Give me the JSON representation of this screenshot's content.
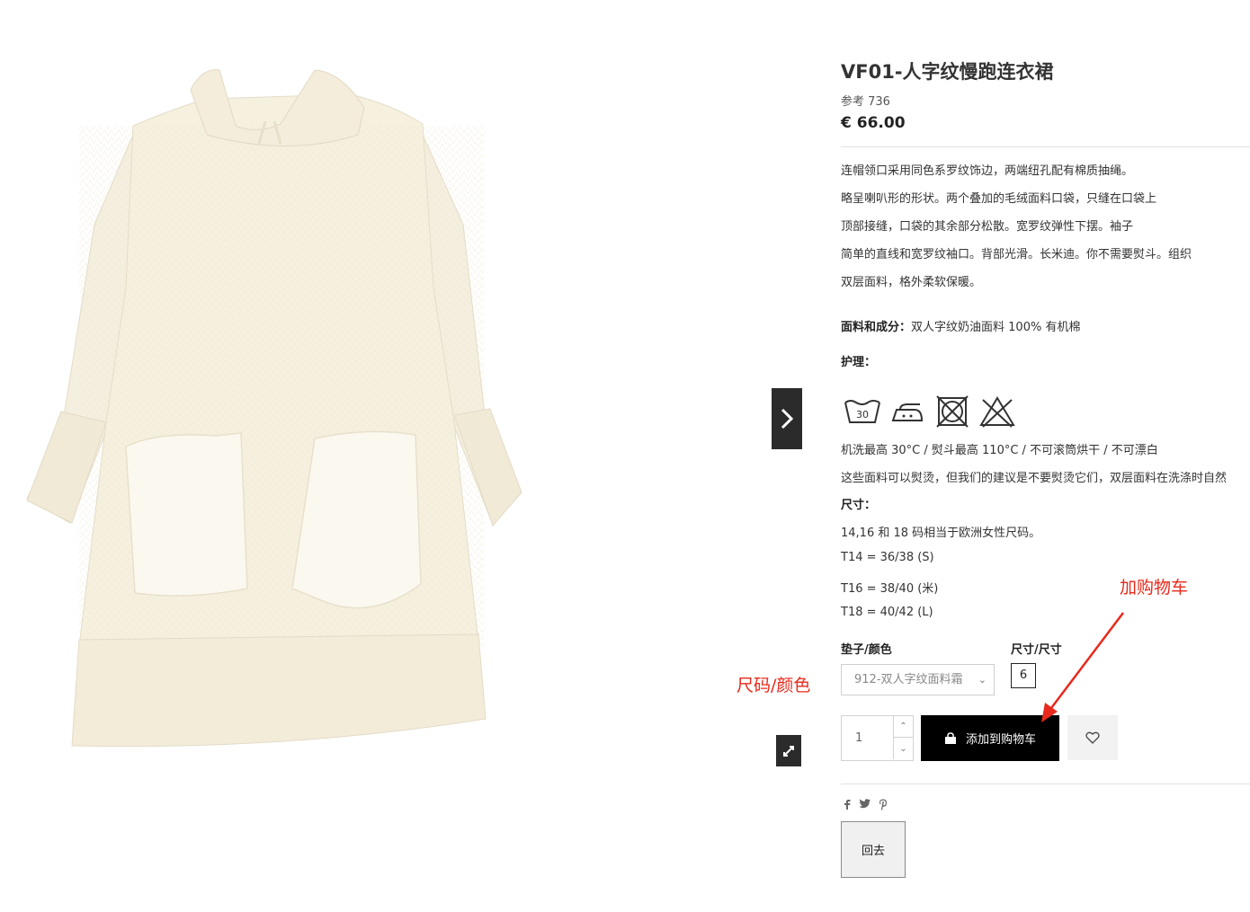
{
  "product": {
    "title": "VF01-人字纹慢跑连衣裙",
    "reference": "参考 736",
    "price": "€ 66.00",
    "description": [
      "连帽领口采用同色系罗纹饰边，两端纽孔配有棉质抽绳。",
      "略呈喇叭形的形状。两个叠加的毛绒面料口袋，只缝在口袋上",
      "顶部接缝，口袋的其余部分松散。宽罗纹弹性下摆。袖子",
      "简单的直线和宽罗纹袖口。背部光滑。长米迪。你不需要熨斗。组织",
      "双层面料，格外柔软保暖。"
    ],
    "composition_label": "面料和成分：",
    "composition_value": "双人字纹奶油面料 100% 有机棉",
    "care_label": "护理：",
    "care_icons": [
      "wash-30-icon",
      "iron-medium-icon",
      "no-tumble-dry-icon",
      "no-bleach-icon"
    ],
    "care_text": "机洗最高 30°C / 熨斗最高 110°C / 不可滚筒烘干 / 不可漂白",
    "care_note": "这些面料可以熨烫，但我们的建议是不要熨烫它们，双层面料在洗涤时自然",
    "size_heading": "尺寸：",
    "size_lines": [
      "14,16 和 18 码相当于欧洲女性尺码。",
      "T14 = 36/38 (S)",
      "T16 = 38/40 (米)",
      "T18 = 40/42 (L)"
    ]
  },
  "options": {
    "color_label": "垫子/颜色",
    "color_value": "912-双人字纹面料霜",
    "size_label": "尺寸/尺寸",
    "size_value": "6"
  },
  "cart": {
    "quantity": "1",
    "add_label": "添加到购物车"
  },
  "back_label": "回去",
  "social_icons": [
    "facebook-icon",
    "twitter-icon",
    "pinterest-icon"
  ],
  "annotations": {
    "add_cart": "加购物车",
    "size_color": "尺码/颜色"
  },
  "colors": {
    "annotation": "#e8291c",
    "button": "#000000",
    "dress": "#f6f0df"
  }
}
